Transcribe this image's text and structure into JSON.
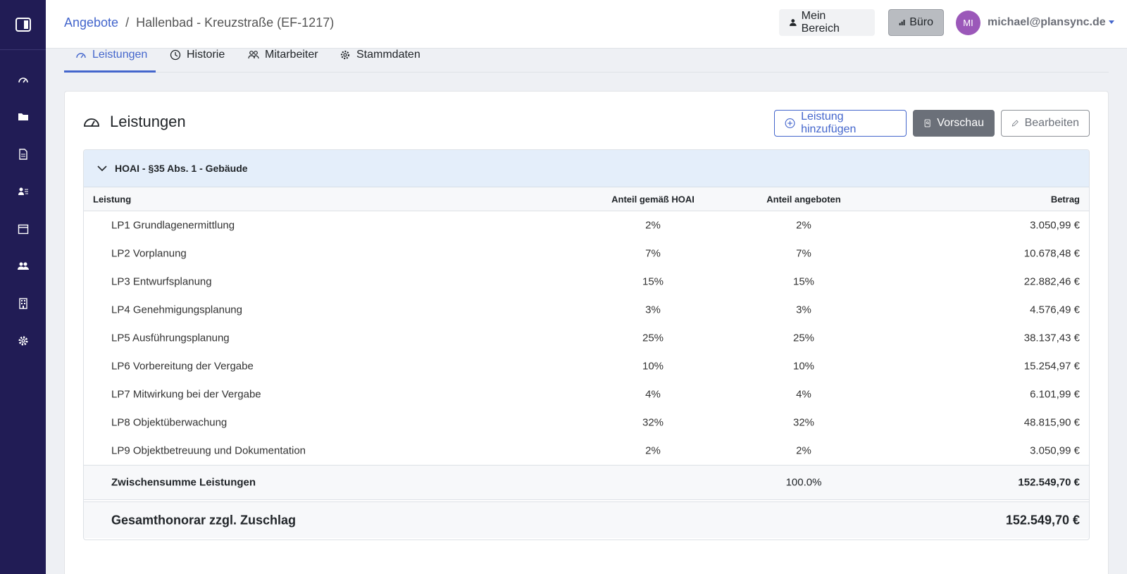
{
  "header": {
    "breadcrumb_link": "Angebote",
    "breadcrumb_sep": "/",
    "breadcrumb_current": "Hallenbad - Kreuzstraße (EF-1217)",
    "mein_bereich": "Mein Bereich",
    "buero": "Büro",
    "avatar_initials": "MI",
    "user_email": "michael@plansync.de"
  },
  "tabs": [
    {
      "label": "Leistungen"
    },
    {
      "label": "Historie"
    },
    {
      "label": "Mitarbeiter"
    },
    {
      "label": "Stammdaten"
    }
  ],
  "card": {
    "title": "Leistungen",
    "add_label": "Leistung hinzufügen",
    "preview_label": "Vorschau",
    "edit_label": "Bearbeiten"
  },
  "group": {
    "title": "HOAI - §35 Abs. 1 - Gebäude",
    "columns": [
      "Leistung",
      "Anteil gemäß HOAI",
      "Anteil angeboten",
      "Betrag"
    ],
    "rows": [
      {
        "name": "LP1 Grundlagenermittlung",
        "hoai": "2%",
        "angeboten": "2%",
        "betrag": "3.050,99 €"
      },
      {
        "name": "LP2 Vorplanung",
        "hoai": "7%",
        "angeboten": "7%",
        "betrag": "10.678,48 €"
      },
      {
        "name": "LP3 Entwurfsplanung",
        "hoai": "15%",
        "angeboten": "15%",
        "betrag": "22.882,46 €"
      },
      {
        "name": "LP4 Genehmigungsplanung",
        "hoai": "3%",
        "angeboten": "3%",
        "betrag": "4.576,49 €"
      },
      {
        "name": "LP5 Ausführungsplanung",
        "hoai": "25%",
        "angeboten": "25%",
        "betrag": "38.137,43 €"
      },
      {
        "name": "LP6 Vorbereitung der Vergabe",
        "hoai": "10%",
        "angeboten": "10%",
        "betrag": "15.254,97 €"
      },
      {
        "name": "LP7 Mitwirkung bei der Vergabe",
        "hoai": "4%",
        "angeboten": "4%",
        "betrag": "6.101,99 €"
      },
      {
        "name": "LP8 Objektüberwachung",
        "hoai": "32%",
        "angeboten": "32%",
        "betrag": "48.815,90 €"
      },
      {
        "name": "LP9 Objektbetreuung und Dokumentation",
        "hoai": "2%",
        "angeboten": "2%",
        "betrag": "3.050,99 €"
      }
    ],
    "subtotal": {
      "label": "Zwischensumme Leistungen",
      "angeboten": "100.0%",
      "betrag": "152.549,70 €"
    },
    "total": {
      "label": "Gesamthonorar zzgl. Zuschlag",
      "betrag": "152.549,70 €"
    }
  },
  "sidebar": {
    "items": [
      "dashboard-icon",
      "folder-icon",
      "document-icon",
      "contacts-icon",
      "calendar-icon",
      "users-icon",
      "building-icon",
      "settings-icon"
    ]
  }
}
